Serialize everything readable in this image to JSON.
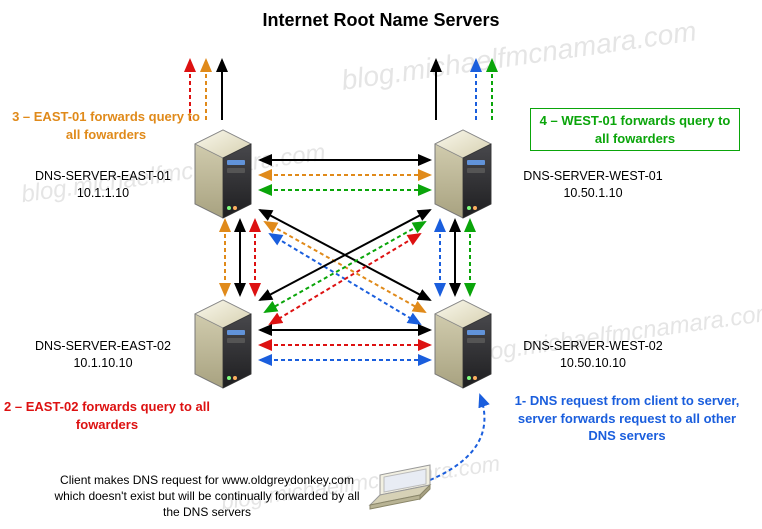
{
  "title": "Internet Root Name Servers",
  "watermark": "blog.michaelfmcnamara.com",
  "servers": {
    "east01": {
      "name": "DNS-SERVER-EAST-01",
      "ip": "10.1.1.10"
    },
    "east02": {
      "name": "DNS-SERVER-EAST-02",
      "ip": "10.1.10.10"
    },
    "west01": {
      "name": "DNS-SERVER-WEST-01",
      "ip": "10.50.1.10"
    },
    "west02": {
      "name": "DNS-SERVER-WEST-02",
      "ip": "10.50.10.10"
    }
  },
  "steps": {
    "s1": "1- DNS request from client to server, server forwards request to all other DNS servers",
    "s2": "2 – EAST-02 forwards query to all fowarders",
    "s3": "3 – EAST-01 forwards query to all fowarders",
    "s4": "4 – WEST-01 forwards query to all fowarders"
  },
  "client_caption": "Client makes DNS request for www.oldgreydonkey.com which doesn't exist but will be continually forwarded by all the DNS servers",
  "icons": {
    "server": "server-icon",
    "laptop": "laptop-icon"
  },
  "colors": {
    "orange": "#e08a1a",
    "red": "#dd1111",
    "green": "#0aa50a",
    "blue": "#1a5edd",
    "black": "#000000"
  }
}
